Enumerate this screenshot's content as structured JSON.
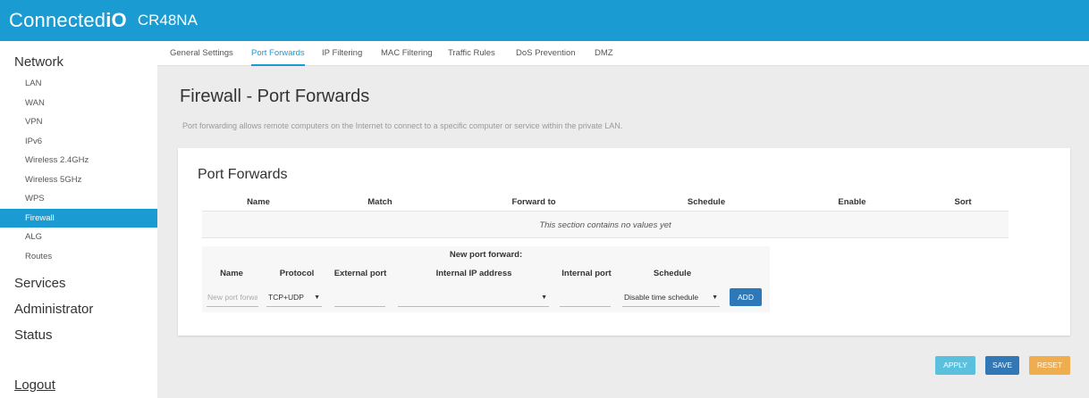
{
  "header": {
    "logo_text": "Connected",
    "logo_bold": "iO",
    "model": "CR48NA",
    "accent_color": "#1a9bd1"
  },
  "sidebar": {
    "network": "Network",
    "items": [
      "LAN",
      "WAN",
      "VPN",
      "IPv6",
      "Wireless 2.4GHz",
      "Wireless 5GHz",
      "WPS",
      "Firewall",
      "ALG",
      "Routes"
    ],
    "active_item": "Firewall",
    "services": "Services",
    "administrator": "Administrator",
    "status": "Status",
    "logout": "Logout"
  },
  "tabs": [
    "General Settings",
    "Port Forwards",
    "IP Filtering",
    "MAC Filtering",
    "Traffic Rules",
    "DoS Prevention",
    "DMZ"
  ],
  "active_tab": "Port Forwards",
  "page": {
    "title": "Firewall - Port Forwards",
    "description": "Port forwarding allows remote computers on the Internet to connect to a specific computer or service within the private LAN."
  },
  "section": {
    "title": "Port Forwards",
    "columns": [
      "Name",
      "Match",
      "Forward to",
      "Schedule",
      "Enable",
      "Sort"
    ],
    "empty_text": "This section contains no values yet"
  },
  "new_forward": {
    "title": "New port forward:",
    "columns": [
      "Name",
      "Protocol",
      "External port",
      "Internal IP address",
      "Internal port",
      "Schedule"
    ],
    "name_placeholder": "New port forward",
    "protocol_value": "TCP+UDP",
    "internal_ip_value": "",
    "schedule_value": "Disable time schedule",
    "add_label": "ADD"
  },
  "actions": {
    "apply": "APPLY",
    "save": "SAVE",
    "reset": "RESET"
  }
}
